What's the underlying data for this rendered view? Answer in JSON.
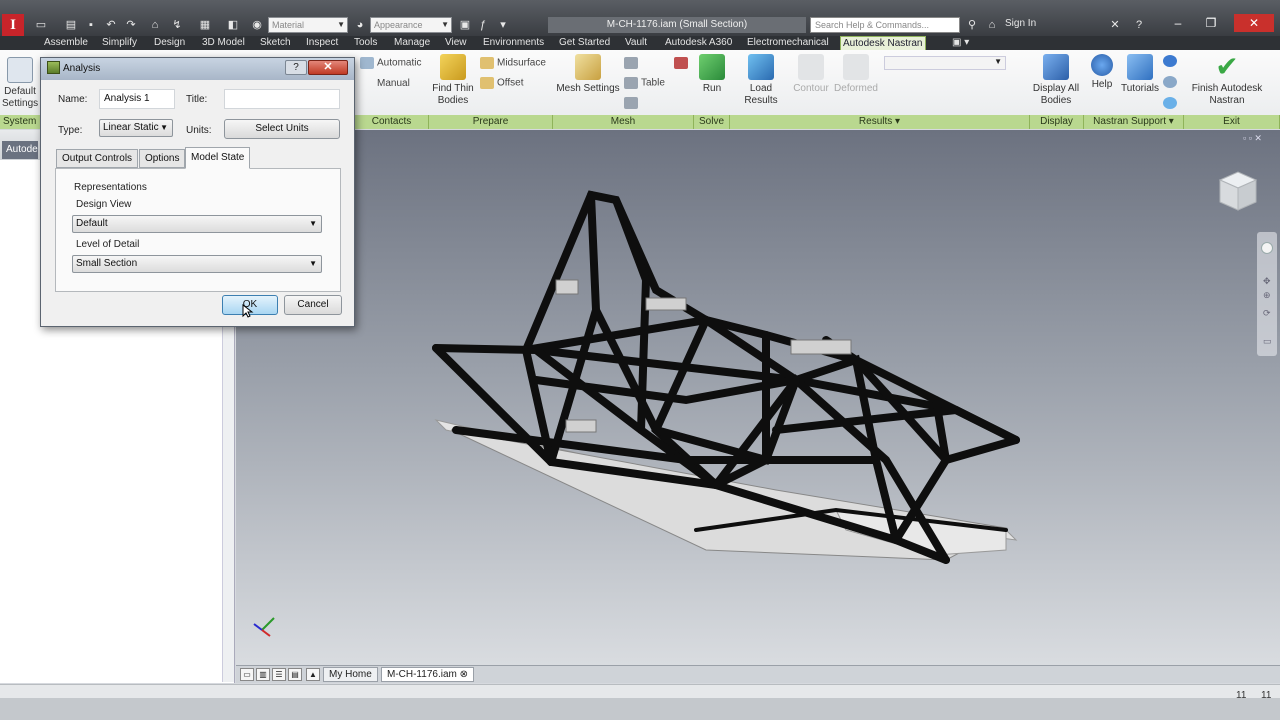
{
  "app": {
    "logo_letter": "I",
    "document_title": "M-CH-1176.iam (Small Section)",
    "search_placeholder": "Search Help & Commands...",
    "sign_in": "Sign In",
    "qat_material": "Material",
    "qat_appearance": "Appearance"
  },
  "ribbon_tabs": [
    "Assemble",
    "Simplify",
    "Design",
    "3D Model",
    "Sketch",
    "Inspect",
    "Tools",
    "Manage",
    "View",
    "Environments",
    "Get Started",
    "Vault",
    "Autodesk A360",
    "Electromechanical",
    "Autodesk Nastran"
  ],
  "active_tab": "Autodesk Nastran",
  "ribbon": {
    "default_settings": "Default Settings",
    "system_panel": "System",
    "contacts": {
      "automatic": "Automatic",
      "manual": "Manual",
      "panel": "Contacts"
    },
    "prepare": {
      "find_thin_bodies": "Find Thin Bodies",
      "midsurface": "Midsurface",
      "offset": "Offset",
      "panel": "Prepare"
    },
    "mesh": {
      "mesh_settings": "Mesh Settings",
      "table": "Table",
      "panel": "Mesh"
    },
    "solve": {
      "run": "Run",
      "panel": "Solve"
    },
    "results": {
      "load_results": "Load Results",
      "contour": "Contour",
      "deformed": "Deformed",
      "panel": "Results"
    },
    "display": {
      "display_all_bodies": "Display All Bodies",
      "panel": "Display"
    },
    "support": {
      "help": "Help",
      "tutorials": "Tutorials",
      "panel": "Nastran Support"
    },
    "exit": {
      "finish": "Finish Autodesk Nastran",
      "panel": "Exit"
    }
  },
  "browser": {
    "tab_label": "Autodesk"
  },
  "dialog": {
    "title": "Analysis",
    "help_glyph": "?",
    "close_glyph": "✕",
    "name_label": "Name:",
    "name_value": "Analysis 1",
    "title_label": "Title:",
    "title_value": "",
    "type_label": "Type:",
    "type_value": "Linear Static",
    "units_label": "Units:",
    "select_units_button": "Select Units",
    "tabs": [
      "Output Controls",
      "Options",
      "Model State"
    ],
    "active_tab": "Model State",
    "representations_label": "Representations",
    "design_view_label": "Design View",
    "design_view_value": "Default",
    "level_of_detail_label": "Level of Detail",
    "level_of_detail_value": "Small Section",
    "ok_button": "OK",
    "cancel_button": "Cancel"
  },
  "document_tabs": {
    "home": "My Home",
    "file": "M-CH-1176.iam"
  },
  "status": {
    "count_left": "11",
    "count_right": "11"
  },
  "colors": {
    "ribbon_panel_label": "#b9d88f",
    "active_tab": "#e8f0d8",
    "close_red": "#c9302c",
    "finish_check": "#3aa845",
    "frame": "#111111"
  }
}
